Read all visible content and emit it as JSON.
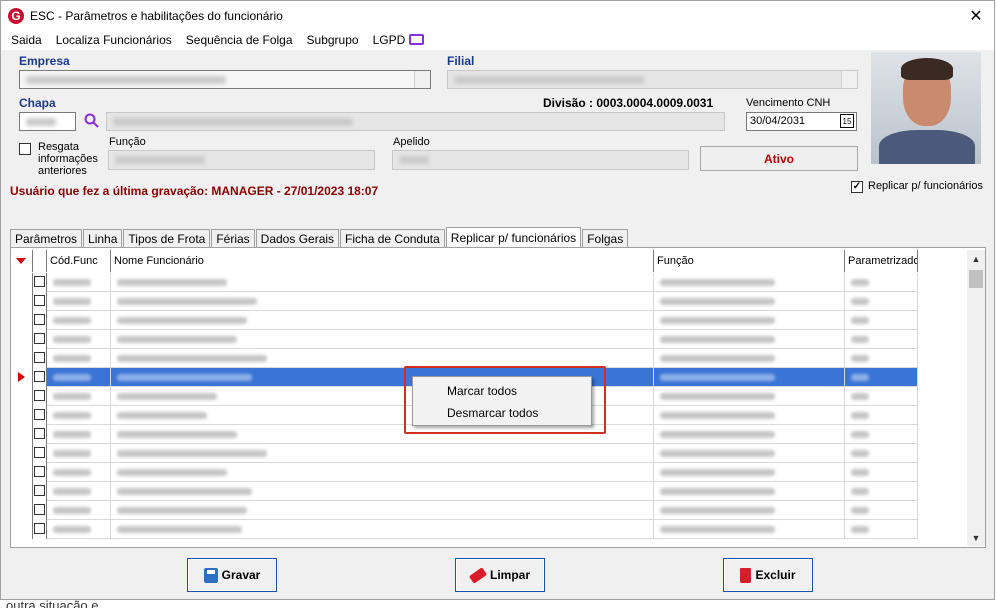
{
  "window": {
    "title": "ESC - Parâmetros e habilitações do funcionário",
    "app_icon_letter": "G",
    "close_glyph": "✕"
  },
  "menu": [
    "Saida",
    "Localiza Funcionários",
    "Sequência de Folga",
    "Subgrupo",
    "LGPD"
  ],
  "form": {
    "empresa_label": "Empresa",
    "filial_label": "Filial",
    "chapa_label": "Chapa",
    "divisao": "Divisão : 0003.0004.0009.0031",
    "vencimento_label": "Vencimento  CNH",
    "vencimento_value": "30/04/2031",
    "calendar_glyph": "15",
    "resgata_label": "Resgata informações anteriores",
    "funcao_label": "Função",
    "apelido_label": "Apelido",
    "status_button": "Ativo",
    "replicar_checkbox_label": "Replicar p/ funcionários",
    "replicar_checked": true,
    "last_save": "Usuário que fez a última gravação: MANAGER - 27/01/2023 18:07"
  },
  "tabs": [
    {
      "label": "Parâmetros"
    },
    {
      "label": "Linha"
    },
    {
      "label": "Tipos de Frota"
    },
    {
      "label": "Férias"
    },
    {
      "label": "Dados Gerais"
    },
    {
      "label": "Ficha de Conduta"
    },
    {
      "label": "Replicar p/ funcionários",
      "active": true
    },
    {
      "label": "Folgas"
    }
  ],
  "grid": {
    "columns": [
      "",
      "",
      "Cód.Func",
      "Nome Funcionário",
      "Função",
      "Parametrizado"
    ],
    "row_count": 14,
    "selected_row": 5
  },
  "context_menu": {
    "items": [
      "Marcar todos",
      "Desmarcar todos"
    ]
  },
  "buttons": {
    "save": "Gravar",
    "clear": "Limpar",
    "delete": "Excluir"
  },
  "background_text": "outra situação e"
}
